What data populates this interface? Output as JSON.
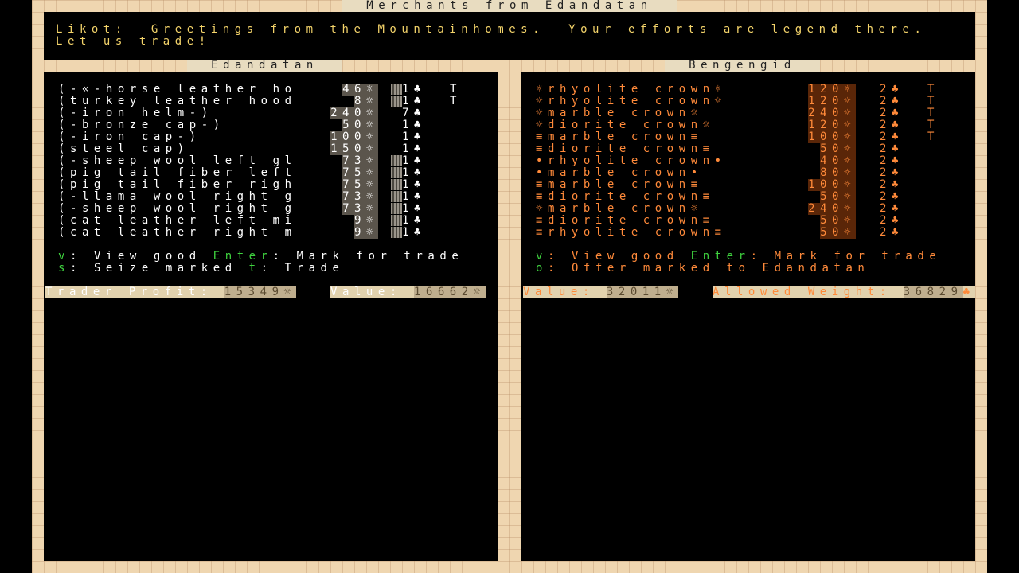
{
  "window_title": "Merchants from Edandatan",
  "message": {
    "speaker": "Likot:",
    "line1": "Greetings from the Mountainhomes.  Your efforts are legend there.",
    "line2": "Let us trade!"
  },
  "left_panel": {
    "title": "Edandatan",
    "items": [
      {
        "name": "(-«-horse leather ho",
        "value": "46☼",
        "weight": "1",
        "bin": true,
        "flag": "T"
      },
      {
        "name": "(turkey leather hood",
        "value": "8☼",
        "weight": "1",
        "bin": true,
        "flag": "T"
      },
      {
        "name": "(-iron helm-)",
        "value": "240☼",
        "weight": "7",
        "bin": false,
        "flag": ""
      },
      {
        "name": "(-bronze cap-)",
        "value": "50☼",
        "weight": "1",
        "bin": false,
        "flag": ""
      },
      {
        "name": "(-iron cap-)",
        "value": "100☼",
        "weight": "1",
        "bin": false,
        "flag": ""
      },
      {
        "name": "(steel cap)",
        "value": "150☼",
        "weight": "1",
        "bin": false,
        "flag": ""
      },
      {
        "name": "(-sheep wool left gl",
        "value": "73☼",
        "weight": "1",
        "bin": true,
        "flag": ""
      },
      {
        "name": "(pig tail fiber left",
        "value": "75☼",
        "weight": "1",
        "bin": true,
        "flag": ""
      },
      {
        "name": "(pig tail fiber righ",
        "value": "75☼",
        "weight": "1",
        "bin": true,
        "flag": ""
      },
      {
        "name": "(-llama wool right g",
        "value": "73☼",
        "weight": "1",
        "bin": true,
        "flag": ""
      },
      {
        "name": "(-sheep wool right g",
        "value": "73☼",
        "weight": "1",
        "bin": true,
        "flag": ""
      },
      {
        "name": "(cat leather left mi",
        "value": "9☼",
        "weight": "1",
        "bin": true,
        "flag": ""
      },
      {
        "name": "(cat leather right m",
        "value": "9☼",
        "weight": "1",
        "bin": true,
        "flag": ""
      }
    ],
    "help": {
      "k1": "v",
      "t1": ": View good ",
      "k2": "Enter",
      "t2": ": Mark for trade",
      "k3": "s",
      "t3": ": Seize marked ",
      "k4": "t",
      "t4": ": Trade"
    },
    "profit_label": "Trader Profit: ",
    "profit_value": "15349☼",
    "value_label": "Value: ",
    "value_value": "16662☼"
  },
  "right_panel": {
    "title": "Bengengid",
    "items": [
      {
        "name": "☼rhyolite crown☼",
        "value": "120☼",
        "weight": "2",
        "flag": "T"
      },
      {
        "name": "☼rhyolite crown☼",
        "value": "120☼",
        "weight": "2",
        "flag": "T"
      },
      {
        "name": "☼marble crown☼",
        "value": "240☼",
        "weight": "2",
        "flag": "T"
      },
      {
        "name": "☼diorite crown☼",
        "value": "120☼",
        "weight": "2",
        "flag": "T"
      },
      {
        "name": "≡marble crown≡",
        "value": "100☼",
        "weight": "2",
        "flag": "T"
      },
      {
        "name": "≡diorite crown≡",
        "value": "50☼",
        "weight": "2",
        "flag": ""
      },
      {
        "name": "•rhyolite crown•",
        "value": "40☼",
        "weight": "2",
        "flag": ""
      },
      {
        "name": "•marble crown•",
        "value": "80☼",
        "weight": "2",
        "flag": ""
      },
      {
        "name": "≡marble crown≡",
        "value": "100☼",
        "weight": "2",
        "flag": ""
      },
      {
        "name": "≡diorite crown≡",
        "value": "50☼",
        "weight": "2",
        "flag": ""
      },
      {
        "name": "☼marble crown☼",
        "value": "240☼",
        "weight": "2",
        "flag": ""
      },
      {
        "name": "≡diorite crown≡",
        "value": "50☼",
        "weight": "2",
        "flag": ""
      },
      {
        "name": "≡rhyolite crown≡",
        "value": "50☼",
        "weight": "2",
        "flag": ""
      }
    ],
    "help": {
      "k1": "v",
      "t1": ": View good ",
      "k2": "Enter",
      "t2": ": Mark for trade",
      "k3": "o",
      "t3": ": Offer marked to Edandatan"
    },
    "value_label": "Value: ",
    "value_value": "32011☼",
    "weight_label": "Allowed Weight: ",
    "weight_value": "36829"
  },
  "colors": {
    "left_text": "#ffffff",
    "right_text": "#ff8a3a",
    "key": "#3fd33f",
    "message": "#f3d36a"
  }
}
